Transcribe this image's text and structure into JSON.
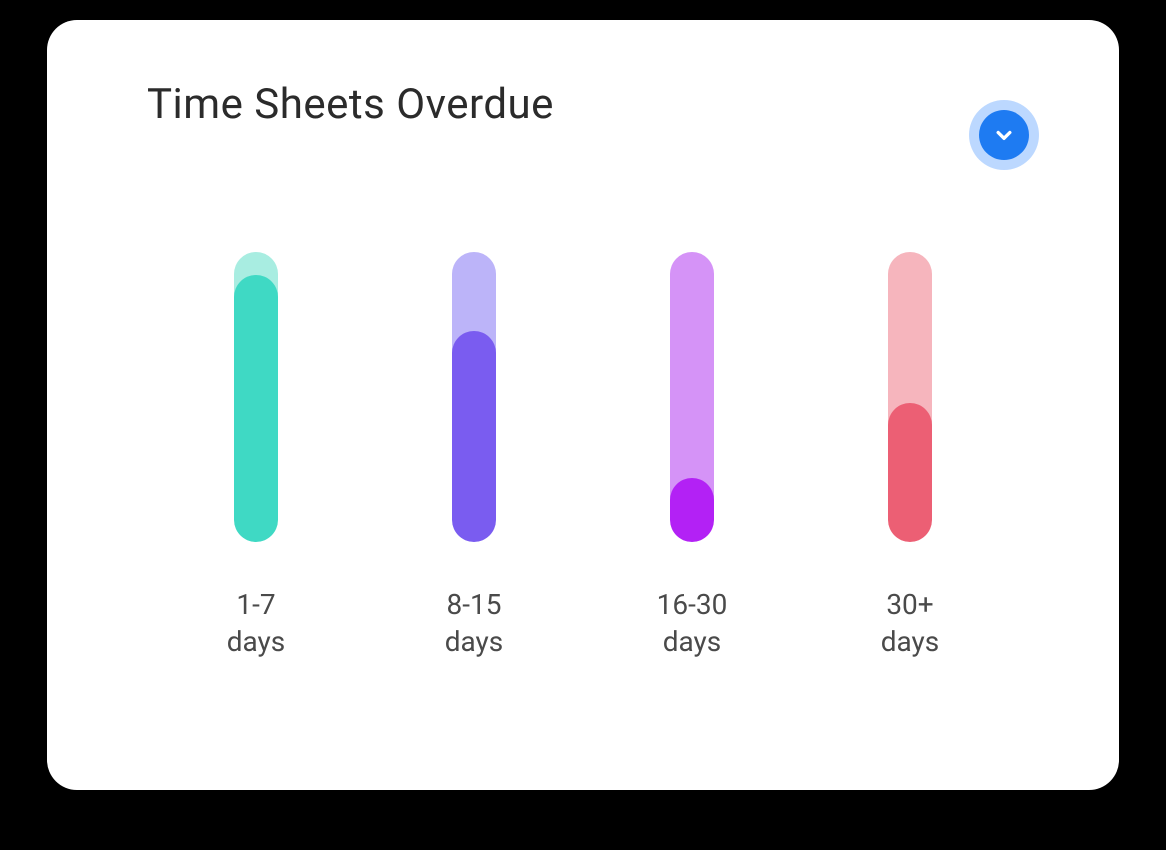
{
  "header": {
    "title": "Time Sheets Overdue"
  },
  "chart_data": {
    "type": "bar",
    "categories": [
      "1-7 days",
      "8-15 days",
      "16-30 days",
      "30+ days"
    ],
    "series": [
      {
        "name": "foreground_fill_percent",
        "values": [
          92,
          73,
          22,
          48
        ]
      }
    ],
    "title": "Time Sheets Overdue",
    "xlabel": "",
    "ylabel": "",
    "ylim": [
      0,
      100
    ],
    "colors": {
      "tracks": [
        "#a8ede1",
        "#bcb4f9",
        "#d593f7",
        "#f6b5bd"
      ],
      "fills": [
        "#3fd9c4",
        "#7a5cf0",
        "#b321f5",
        "#ec5f74"
      ]
    },
    "labels_top": [
      "1-7",
      "8-15",
      "16-30",
      "30+"
    ],
    "labels_bottom": "days"
  }
}
